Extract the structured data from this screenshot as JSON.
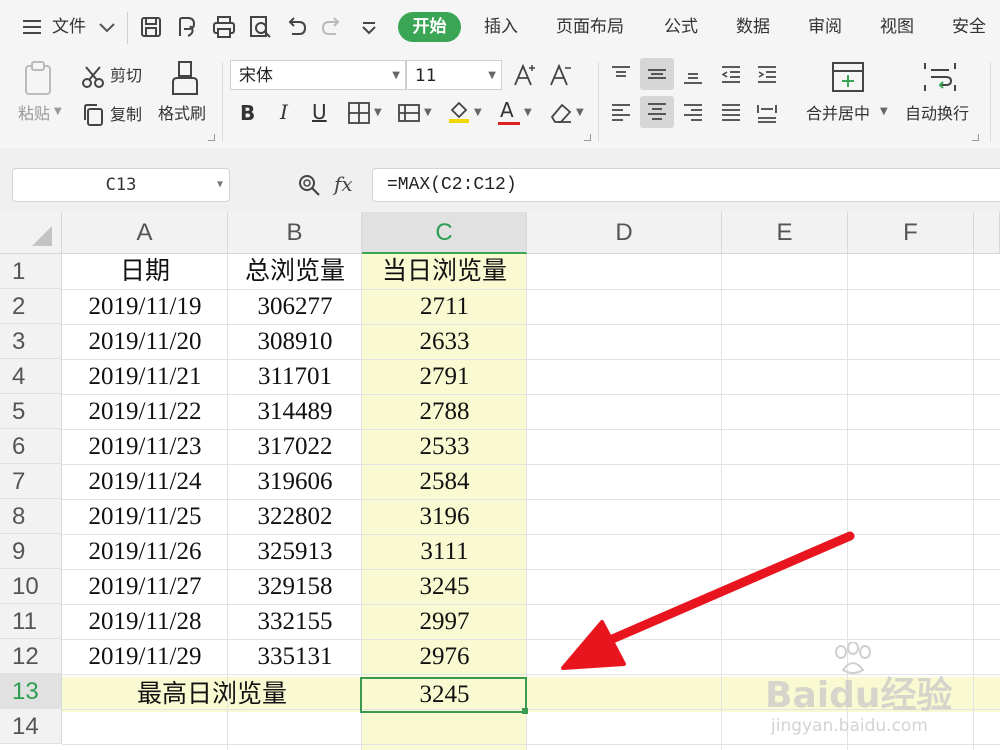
{
  "menubar": {
    "file_label": "文件",
    "tabs": [
      "开始",
      "插入",
      "页面布局",
      "公式",
      "数据",
      "审阅",
      "视图",
      "安全"
    ],
    "active_tab": "开始"
  },
  "ribbon": {
    "paste_label": "粘贴",
    "cut_label": "剪切",
    "copy_label": "复制",
    "format_painter_label": "格式刷",
    "font_name": "宋体",
    "font_size": "11",
    "bold_label": "B",
    "italic_label": "I",
    "underline_label": "U",
    "font_color_letter": "A",
    "merge_center_label": "合并居中",
    "wrap_text_label": "自动换行",
    "accent_color": "#3aa655"
  },
  "formula_bar": {
    "cell_ref": "C13",
    "fx_label": "fx",
    "formula": "=MAX(C2:C12)"
  },
  "sheet": {
    "columns": [
      "A",
      "B",
      "C",
      "D",
      "E",
      "F"
    ],
    "rows": [
      "1",
      "2",
      "3",
      "4",
      "5",
      "6",
      "7",
      "8",
      "9",
      "10",
      "11",
      "12",
      "13",
      "14"
    ],
    "header": [
      "日期",
      "总浏览量",
      "当日浏览量"
    ],
    "data": [
      [
        "2019/11/19",
        "306277",
        "2711"
      ],
      [
        "2019/11/20",
        "308910",
        "2633"
      ],
      [
        "2019/11/21",
        "311701",
        "2791"
      ],
      [
        "2019/11/22",
        "314489",
        "2788"
      ],
      [
        "2019/11/23",
        "317022",
        "2533"
      ],
      [
        "2019/11/24",
        "319606",
        "2584"
      ],
      [
        "2019/11/25",
        "322802",
        "3196"
      ],
      [
        "2019/11/26",
        "325913",
        "3111"
      ],
      [
        "2019/11/27",
        "329158",
        "3245"
      ],
      [
        "2019/11/28",
        "332155",
        "2997"
      ],
      [
        "2019/11/29",
        "335131",
        "2976"
      ]
    ],
    "summary_label": "最高日浏览量",
    "summary_value": "3245",
    "active_column": "C",
    "active_row": "13"
  },
  "watermark": {
    "brand": "Baidu经验",
    "url": "jingyan.baidu.com"
  }
}
